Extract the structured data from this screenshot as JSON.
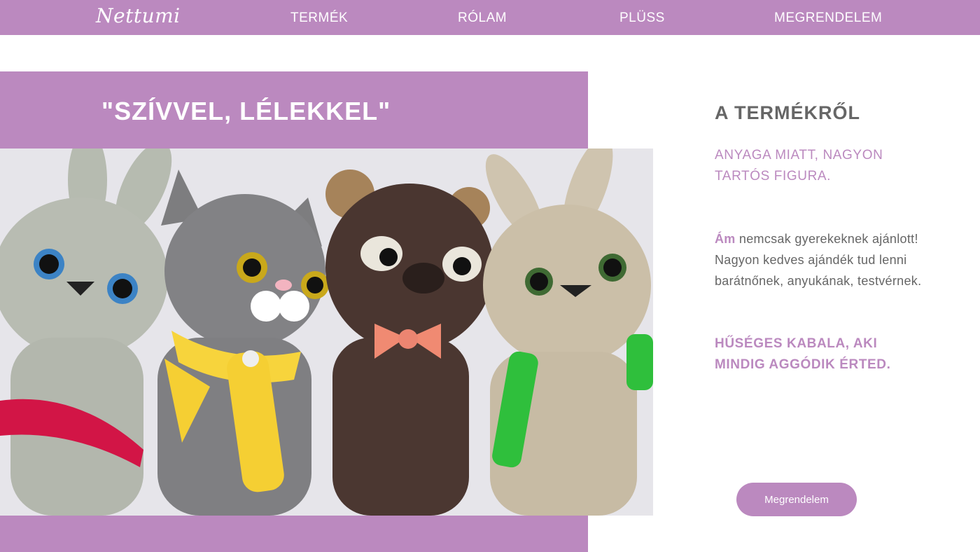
{
  "nav": {
    "logo": "Nettumi",
    "items": [
      "TERMÉK",
      "RÓLAM",
      "PLÜSS",
      "MEGRENDELEM"
    ]
  },
  "hero": {
    "title": "\"SZÍVVEL, LÉLEKKEL\""
  },
  "about": {
    "title": "A TERMÉKRŐL",
    "subtitle": "ANYAGA MIATT, NAGYON TARTÓS FIGURA.",
    "lead": "Ám",
    "body": " nemcsak gyerekeknek ajánlott! Nagyon kedves ajándék tud lenni barátnőnek, anyukának, testvérnek.",
    "highlight": "HŰSÉGES KABALA, AKI MINDIG AGGÓDIK ÉRTED."
  },
  "cta": {
    "label": "Megrendelem"
  },
  "colors": {
    "accent": "#bb89bf",
    "text": "#666666"
  }
}
